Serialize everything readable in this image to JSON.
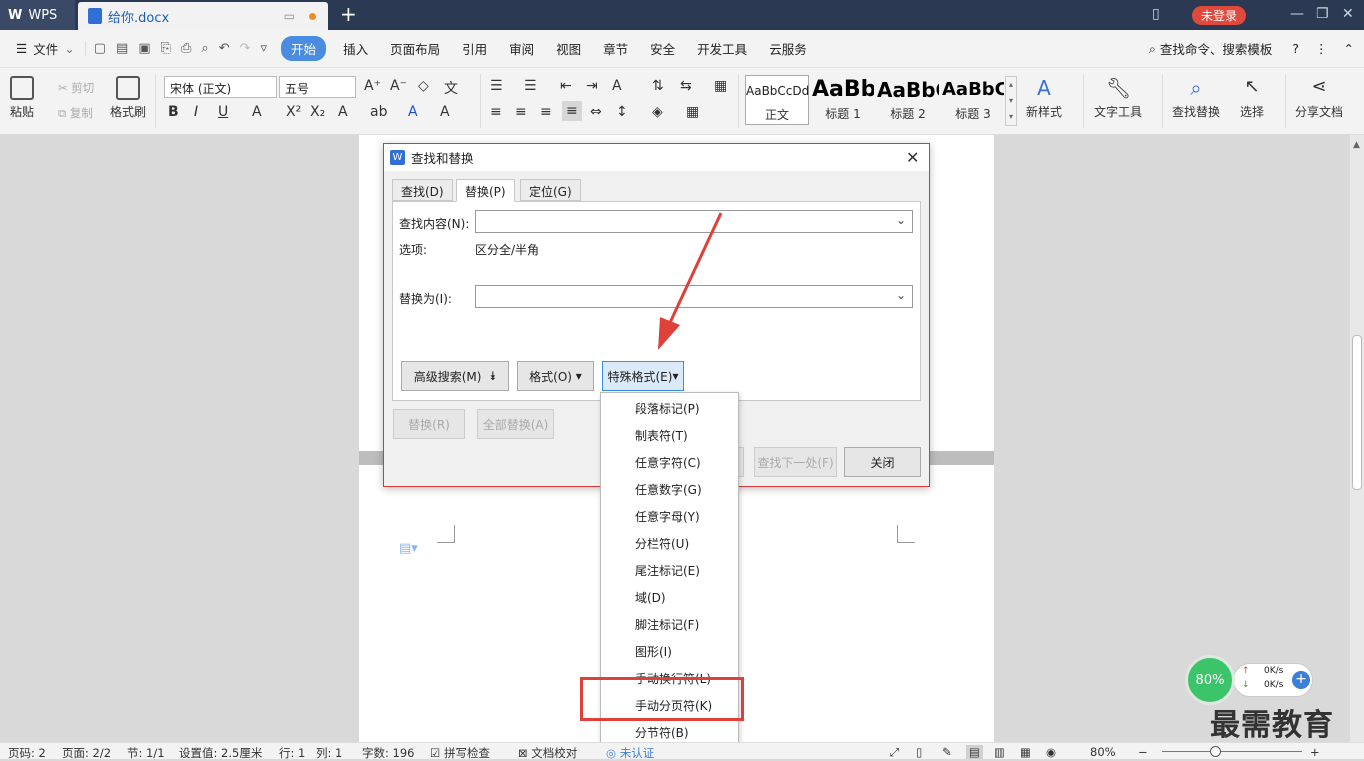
{
  "titlebar": {
    "app_name": "WPS",
    "doc_tab": "给你.docx",
    "new_tab": "+",
    "login": "未登录"
  },
  "menubar": {
    "file": "文件",
    "items": [
      "开始",
      "插入",
      "页面布局",
      "引用",
      "审阅",
      "视图",
      "章节",
      "安全",
      "开发工具",
      "云服务"
    ],
    "active_index": 0,
    "search": "查找命令、搜索模板",
    "help": "?"
  },
  "ribbon": {
    "paste": "粘贴",
    "cut": "剪切",
    "copy": "复制",
    "format_painter": "格式刷",
    "font": "宋体 (正文)",
    "size": "五号",
    "styles": [
      {
        "sample": "AaBbCcDd",
        "label": "正文"
      },
      {
        "sample": "AaBb",
        "label": "标题 1"
      },
      {
        "sample": "AaBbC",
        "label": "标题 2"
      },
      {
        "sample": "AaBbC",
        "label": "标题 3"
      }
    ],
    "new_style": "新样式",
    "text_tools": "文字工具",
    "find_replace": "查找替换",
    "select": "选择",
    "share": "分享文档"
  },
  "dialog": {
    "title": "查找和替换",
    "tabs": [
      "查找(D)",
      "替换(P)",
      "定位(G)"
    ],
    "active_tab": 1,
    "find_label": "查找内容(N):",
    "find_value": "",
    "options_label": "选项:",
    "options_value": "区分全/半角",
    "replace_label": "替换为(I):",
    "replace_value": "",
    "advanced_btn": "高级搜索(M)",
    "format_btn": "格式(O)",
    "special_btn": "特殊格式(E)",
    "replace_btn": "替换(R)",
    "replace_all_btn": "全部替换(A)",
    "find_next_btn": "查找下一处(F)",
    "close_btn": "关闭"
  },
  "special_menu": [
    "段落标记(P)",
    "制表符(T)",
    "任意字符(C)",
    "任意数字(G)",
    "任意字母(Y)",
    "分栏符(U)",
    "尾注标记(E)",
    "域(D)",
    "脚注标记(F)",
    "图形(I)",
    "手动换行符(L)",
    "手动分页符(K)",
    "分节符(B)"
  ],
  "highlighted_item_index": 11,
  "status": {
    "page_no": "页码: 2",
    "pages": "页面: 2/2",
    "section": "节: 1/1",
    "setting": "设置值: 2.5厘米",
    "row": "行: 1",
    "col": "列: 1",
    "words": "字数: 196",
    "spell": "拼写检查",
    "proof": "文档校对",
    "auth": "未认证",
    "zoom": "80%"
  },
  "net_widget": {
    "percent": "80%",
    "up": "0K/s",
    "down": "0K/s"
  },
  "watermark": "最需教育"
}
